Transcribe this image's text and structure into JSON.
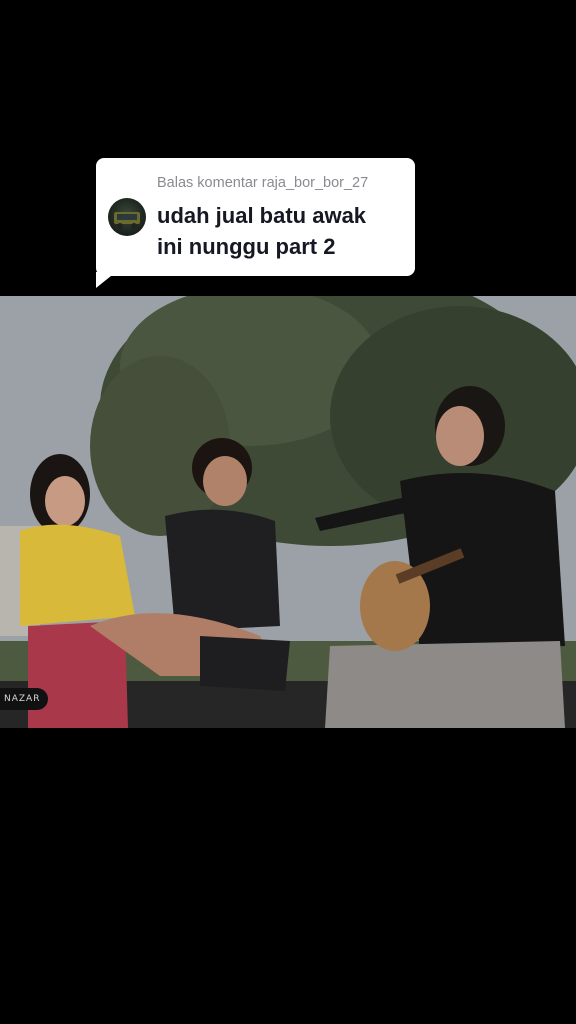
{
  "reply": {
    "header": "Balas komentar raja_bor_bor_27",
    "line1": "udah jual batu awak",
    "line2": "ini nunggu part 2"
  },
  "video": {
    "watermark": "NAZAR"
  },
  "colors": {
    "background": "#000000",
    "bubble": "#ffffff",
    "header_text": "#8a8b91",
    "comment_text": "#161823"
  }
}
